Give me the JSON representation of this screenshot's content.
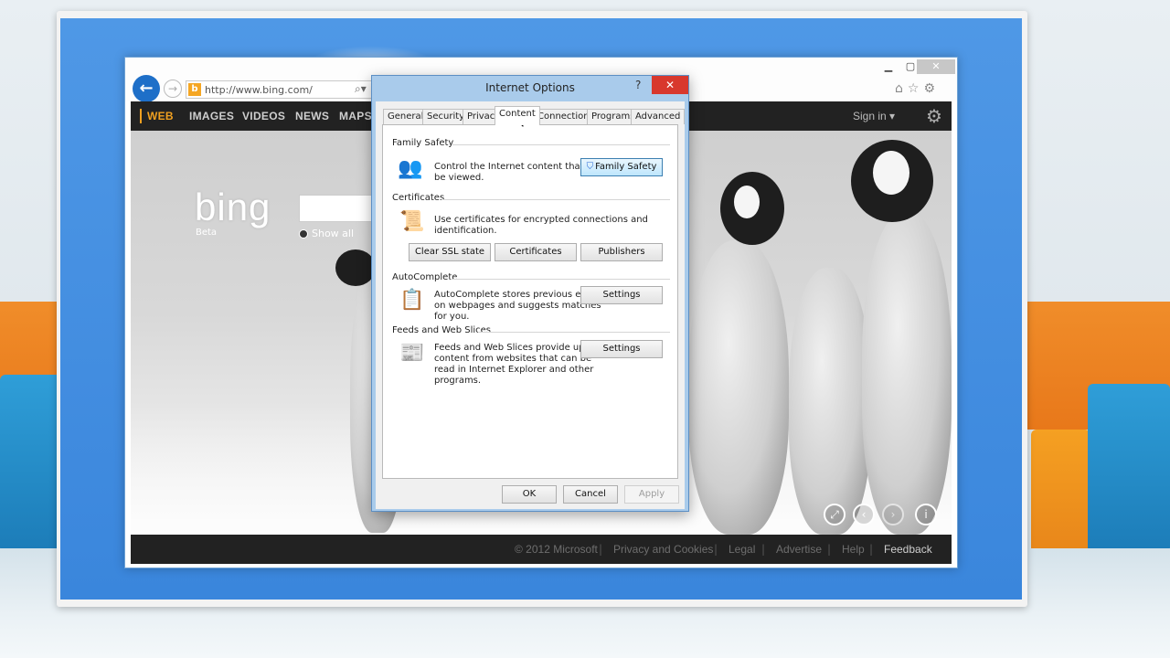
{
  "browser": {
    "address": "http://www.bing.com/",
    "nav_items": [
      {
        "label": "WEB",
        "active": true
      },
      {
        "label": "IMAGES",
        "active": false
      },
      {
        "label": "VIDEOS",
        "active": false
      },
      {
        "label": "NEWS",
        "active": false
      },
      {
        "label": "MAPS",
        "active": false
      }
    ],
    "sign_in": "Sign in ▾",
    "logo": "bing",
    "logo_sub": "Beta",
    "show_all": "Show all",
    "footer": {
      "copyright": "© 2012 Microsoft",
      "privacy": "Privacy and Cookies",
      "legal": "Legal",
      "advertise": "Advertise",
      "help": "Help",
      "feedback": "Feedback"
    }
  },
  "dialog": {
    "title": "Internet Options",
    "help": "?",
    "close": "✕",
    "tabs": [
      "General",
      "Security",
      "Privacy",
      "Content",
      "Connections",
      "Programs",
      "Advanced"
    ],
    "active_tab": "Content",
    "family_safety": {
      "title": "Family Safety",
      "text_1": "Control the Internet content that can",
      "text_2": "be viewed.",
      "button": "Family Safety"
    },
    "certificates": {
      "title": "Certificates",
      "text": "Use certificates for encrypted connections and identification.",
      "clear_ssl": "Clear SSL state",
      "certificates": "Certificates",
      "publishers": "Publishers"
    },
    "autocomplete": {
      "title": "AutoComplete",
      "text_1": "AutoComplete stores previous entries",
      "text_2": "on webpages and suggests matches",
      "text_3": "for you.",
      "button": "Settings"
    },
    "feeds": {
      "title": "Feeds and Web Slices",
      "text_1": "Feeds and Web Slices provide updated",
      "text_2": "content from websites that can be",
      "text_3": "read in Internet Explorer and other",
      "text_4": "programs.",
      "button": "Settings"
    },
    "ok": "OK",
    "cancel": "Cancel",
    "apply": "Apply"
  },
  "colors": {
    "accent_orange": "#f0a020",
    "titlebar_blue": "#a9cbeb",
    "close_red": "#d8382d"
  }
}
